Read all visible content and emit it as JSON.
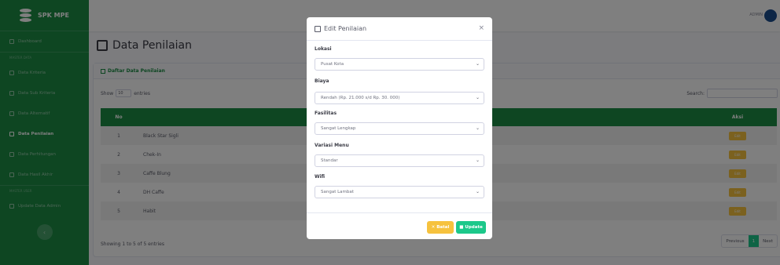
{
  "sidebar": {
    "brand": "SPK MPE",
    "items": [
      {
        "label": "Dashboard"
      },
      {
        "section": "MASTER DATA"
      },
      {
        "label": "Data Kriteria"
      },
      {
        "label": "Data Sub Kriteria"
      },
      {
        "label": "Data Alternatif"
      },
      {
        "label": "Data Penilaian"
      },
      {
        "label": "Data Perhitungan"
      },
      {
        "label": "Data Hasil Akhir"
      },
      {
        "section": "MASTER USER"
      },
      {
        "label": "Update Data Admin"
      }
    ]
  },
  "topbar": {
    "user": "ADMIN"
  },
  "page": {
    "title": "Data Penilaian"
  },
  "card": {
    "title": "Daftar Data Penilaian",
    "show_label": "Show",
    "entries_value": "10",
    "entries_label": "entries",
    "search_label": "Search:",
    "columns": {
      "no": "No",
      "aksi": "Aksi"
    },
    "rows": [
      {
        "no": "1",
        "name": "Black Star Sigli",
        "action": "Edit"
      },
      {
        "no": "2",
        "name": "Chek-In",
        "action": "Edit"
      },
      {
        "no": "3",
        "name": "Caffe Blung",
        "action": "Edit"
      },
      {
        "no": "4",
        "name": "DH Caffe",
        "action": "Edit"
      },
      {
        "no": "5",
        "name": "Habit",
        "action": "Edit"
      }
    ],
    "showing": "Showing 1 to 5 of 5 entries",
    "pager": {
      "prev": "Previous",
      "current": "1",
      "next": "Next"
    }
  },
  "modal": {
    "title": "Edit Penilaian",
    "fields": [
      {
        "label": "Lokasi",
        "value": "Pusat Kota"
      },
      {
        "label": "Biaya",
        "value": "Rendah (Rp. 21.000 s/d Rp. 30. 000)"
      },
      {
        "label": "Fasilitas",
        "value": "Sangat Lengkap"
      },
      {
        "label": "Variasi Menu",
        "value": "Standar"
      },
      {
        "label": "Wifi",
        "value": "Sangat Lambat"
      }
    ],
    "batal_label": "Batal",
    "update_label": "Update"
  }
}
